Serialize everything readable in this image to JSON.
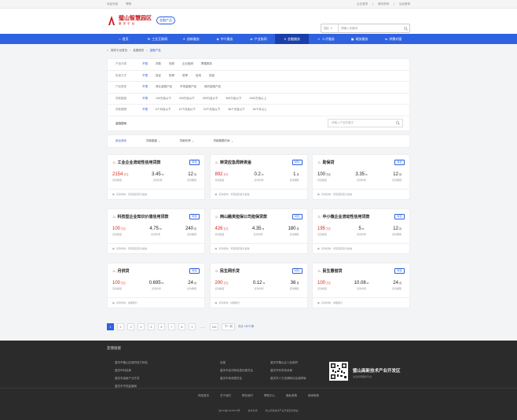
{
  "topbar": {
    "left": [
      "欢迎光临",
      "嘿嘿"
    ],
    "right": [
      "企业登录",
      "服务机构",
      "后台登录"
    ]
  },
  "logo": {
    "title": "璧山智慧园区",
    "subtitle": "服务平台",
    "tag": "金融产品"
  },
  "search": {
    "select": "园区",
    "placeholder": "请输入关键词"
  },
  "nav": [
    "首页",
    "工业互联网",
    "创新服务",
    "中介服务",
    "产业协同",
    "金融服务",
    "人才服务",
    "政务服务",
    "供需对接"
  ],
  "nav_active": 5,
  "breadcrumb": [
    "服务平台首页",
    "金融服务",
    "金融产品"
  ],
  "filters": [
    {
      "label": "产品分类",
      "options": [
        "不限",
        "贷款",
        "债券",
        "企业融资",
        "票据服务"
      ]
    },
    {
      "label": "担保方式",
      "options": [
        "不限",
        "保证",
        "抵押",
        "质押",
        "信用",
        "信保"
      ]
    },
    {
      "label": "产品类型",
      "options": [
        "不限",
        "商业金融产品",
        "市场金融产品",
        "政府金融产品"
      ]
    },
    {
      "label": "贷款额度",
      "options": [
        "不限",
        "100万及以下",
        "200万及以下",
        "300万及以下",
        "500万及以下",
        "1000万及以上"
      ]
    },
    {
      "label": "贷款期限",
      "options": [
        "不限",
        "6个月及以下",
        "12个月及以下",
        "24个月及以下",
        "36个月及以下",
        "36个月以上"
      ]
    }
  ],
  "keyword": {
    "label": "金融搜索",
    "placeholder": "请输入产品关键字"
  },
  "sort": [
    "综合排序",
    "贷款额度",
    "贷款利率",
    "贷款期限时间"
  ],
  "cards": [
    {
      "title": "工业企业流动性信用贷款",
      "btn": "对比",
      "amount": "2154",
      "amount_unit": "万元",
      "rate": "3.45",
      "term": "12",
      "foot": "贷款机构：智慧园区官方金融",
      "red": true
    },
    {
      "title": "转贷应急周转资金",
      "btn": "对比",
      "amount": "892",
      "amount_unit": "万元",
      "rate": "0.2",
      "term": "1",
      "foot": "贷款机构：智慧园区官方金融",
      "red": true
    },
    {
      "title": "助保贷",
      "btn": "对比",
      "amount": "100",
      "amount_unit": "万元",
      "rate": "3.35",
      "term": "12",
      "foot": "贷款机构：智慧园区官方金融",
      "red": false
    },
    {
      "title": "科技型企业知识价值信用贷款",
      "btn": "对比",
      "amount": "100",
      "amount_unit": "万元",
      "rate": "4.75",
      "term": "240",
      "foot": "贷款机构：智慧园区官方金融",
      "red": true
    },
    {
      "title": "两山融资担保公司担保贷款",
      "btn": "对比",
      "amount": "426",
      "amount_unit": "万元",
      "rate": "4.35",
      "term": "180",
      "foot": "贷款机构：智慧园区官方金融",
      "red": true
    },
    {
      "title": "中小微企业流动性信用贷款",
      "btn": "对比",
      "amount": "195",
      "amount_unit": "万元",
      "rate": "5",
      "term": "12",
      "foot": "贷款机构：智慧园区官方金融",
      "red": true
    },
    {
      "title": "月供贷",
      "btn": "对比",
      "amount": "100",
      "amount_unit": "万元",
      "rate": "0.695",
      "term": "24",
      "foot": "贷款机构：成都银行",
      "red": true
    },
    {
      "title": "民生网乐贷",
      "btn": "对比",
      "amount": "200",
      "amount_unit": "万元",
      "rate": "0.12",
      "term": "36",
      "foot": "贷款机构：成都银行",
      "red": true
    },
    {
      "title": "民生惠借贷",
      "btn": "对比",
      "amount": "100",
      "amount_unit": "万元",
      "rate": "10.08",
      "term": "24",
      "foot": "贷款机构：成都银行",
      "red": true
    }
  ],
  "card_labels": {
    "amount": "贷款额度",
    "rate": "贷款利率",
    "term": "贷款期限",
    "rate_unit": "%",
    "term_unit": "月"
  },
  "pager": {
    "pages": [
      "1",
      "2",
      "3",
      "4",
      "5",
      "6",
      "7",
      "8",
      "9"
    ],
    "dots": "......",
    "last": "115",
    "next": "下一页",
    "total_label": "共计",
    "total": "1573",
    "total_unit": "条"
  },
  "footer": {
    "title": "友情链接",
    "links": [
      "重庆市璧山区政府官方网站",
      "百度",
      "重庆市璧山区人民政府",
      "重庆市科技局",
      "重庆市经济和信息化委员会",
      "重庆市科学技术局",
      "重庆市高新产业开发",
      "重庆市商务委员会",
      "重庆市人力资源和社会保障局",
      "重庆市市场监管局",
      "",
      ""
    ],
    "qr_title": "璧山高新技术产业开发区",
    "qr_sub": "关注智慧服务平台",
    "bottom_nav": [
      "网站首页",
      "关于我们",
      "联系我们",
      "帮助中心",
      "隐私政策",
      "使用条款"
    ],
    "copyright": [
      "渝ICP备12345678号",
      "技术支持",
      "璧山高新技术产业开发区管委会"
    ]
  }
}
